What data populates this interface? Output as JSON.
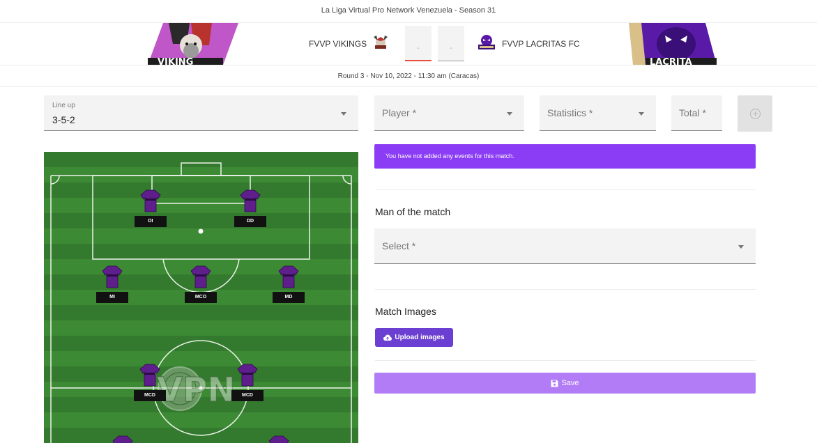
{
  "header": {
    "league_title": "La Liga Virtual Pro Network Venezuela - Season 31",
    "home_team": "FVVP VIKINGS",
    "away_team": "FVVP LACRITAS FC",
    "home_score": "-",
    "away_score": "-",
    "round_info": "Round 3 - Nov 10, 2022 - 11:30 am (Caracas)",
    "home_banner_text": "VIKING",
    "away_banner_text": "LACRITA"
  },
  "lineup": {
    "label": "Line up",
    "value": "3-5-2"
  },
  "event_form": {
    "player_placeholder": "Player *",
    "statistics_placeholder": "Statistics *",
    "total_placeholder": "Total *"
  },
  "alert": {
    "text": "You have not added any events for this match."
  },
  "man_of_match": {
    "title": "Man of the match",
    "placeholder": "Select *"
  },
  "images": {
    "title": "Match Images",
    "upload_label": "Upload images"
  },
  "save_label": "Save",
  "pitch": {
    "watermark": "VPN",
    "players": [
      "DI",
      "DD",
      "MI",
      "MCO",
      "MD",
      "MCD",
      "MCD"
    ]
  },
  "colors": {
    "accent": "#8b3df5",
    "upload": "#6b3fd1",
    "save": "#b27cf7",
    "shirt": "#5e1f8c",
    "score_underline": "#e74c3c"
  }
}
